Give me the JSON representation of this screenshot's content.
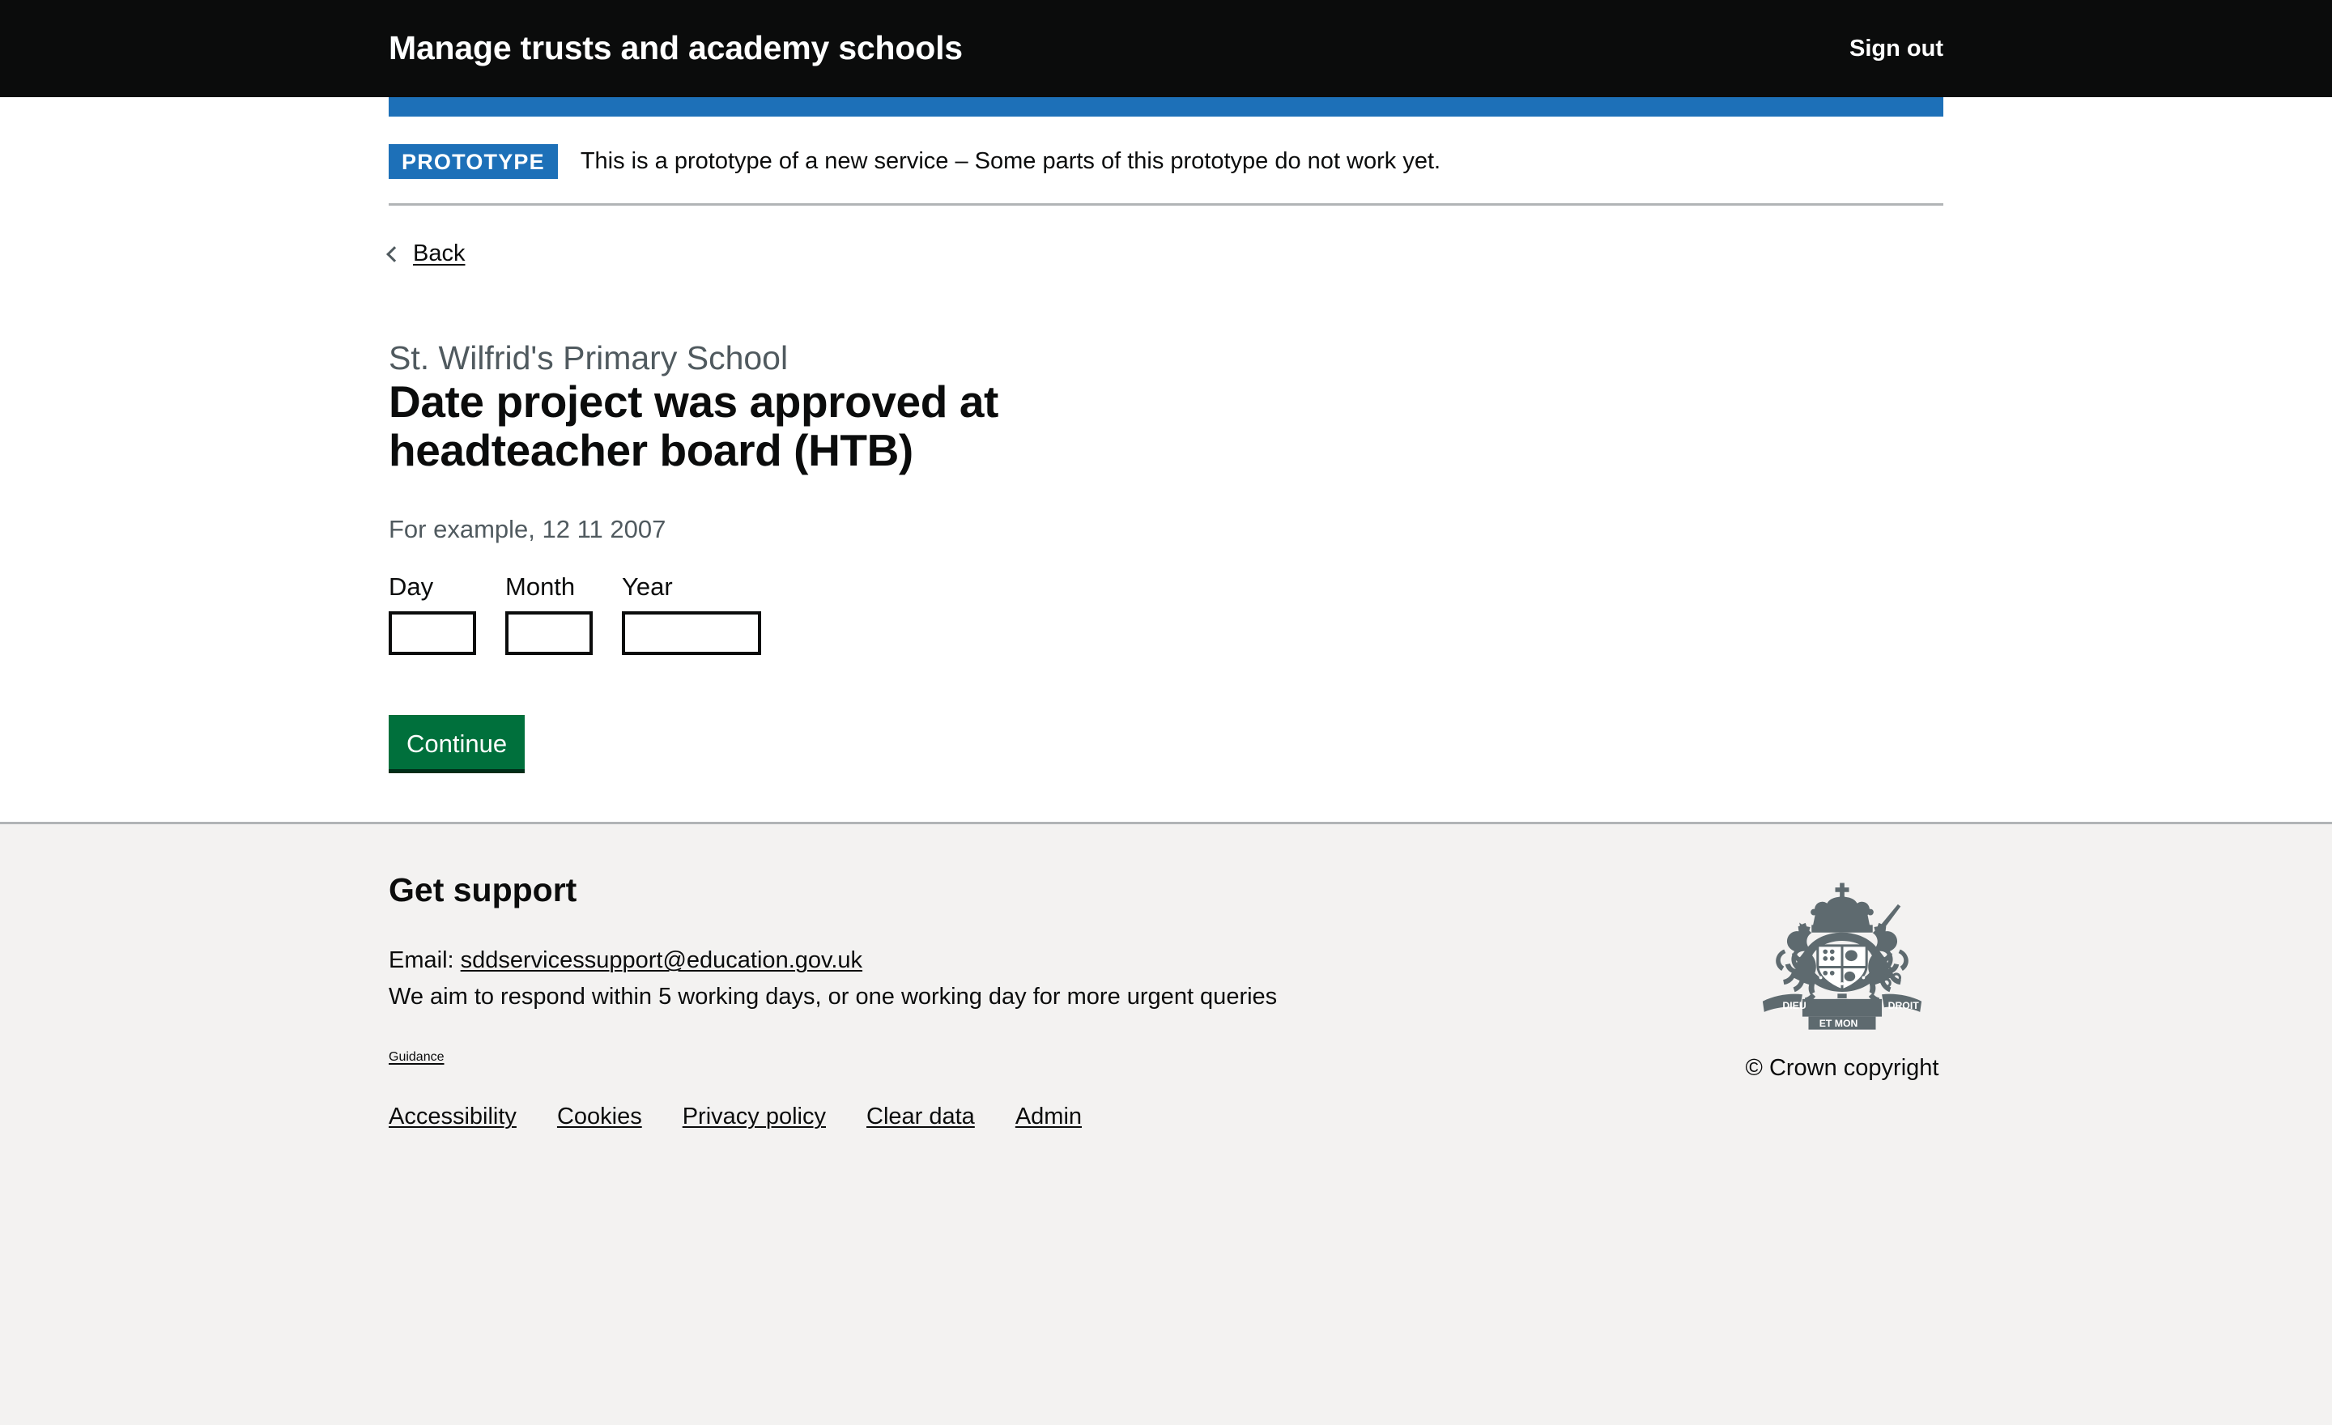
{
  "header": {
    "service_name": "Manage trusts and academy schools",
    "sign_out_label": "Sign out",
    "background_color": "#0b0c0c",
    "accent_color": "#1d70b8"
  },
  "phase_banner": {
    "tag": "PROTOTYPE",
    "text": "This is a prototype of a new service – Some parts of this prototype do not work yet.",
    "tag_color": "#1d70b8"
  },
  "back_link": {
    "label": "Back",
    "icon": "chevron-left-icon"
  },
  "form": {
    "caption": "St. Wilfrid's Primary School",
    "heading": "Date project was approved at headteacher board (HTB)",
    "hint": "For example, 12 11 2007",
    "fields": [
      {
        "label": "Day",
        "value": "",
        "width": "w2"
      },
      {
        "label": "Month",
        "value": "",
        "width": "w2"
      },
      {
        "label": "Year",
        "value": "",
        "width": "w4"
      }
    ],
    "continue_label": "Continue",
    "button_color": "#00703c"
  },
  "footer": {
    "heading": "Get support",
    "email_prefix": "Email: ",
    "email": "sddservicessupport@education.gov.uk",
    "response_time": "We aim to respond within 5 working days, or one working day for more urgent queries",
    "guidance_label": "Guidance",
    "links": [
      {
        "label": "Accessibility"
      },
      {
        "label": "Cookies"
      },
      {
        "label": "Privacy policy"
      },
      {
        "label": "Clear data"
      },
      {
        "label": "Admin"
      }
    ],
    "copyright": "© Crown copyright",
    "crest_icon": "royal-coat-of-arms-icon",
    "background_color": "#f3f2f1"
  }
}
